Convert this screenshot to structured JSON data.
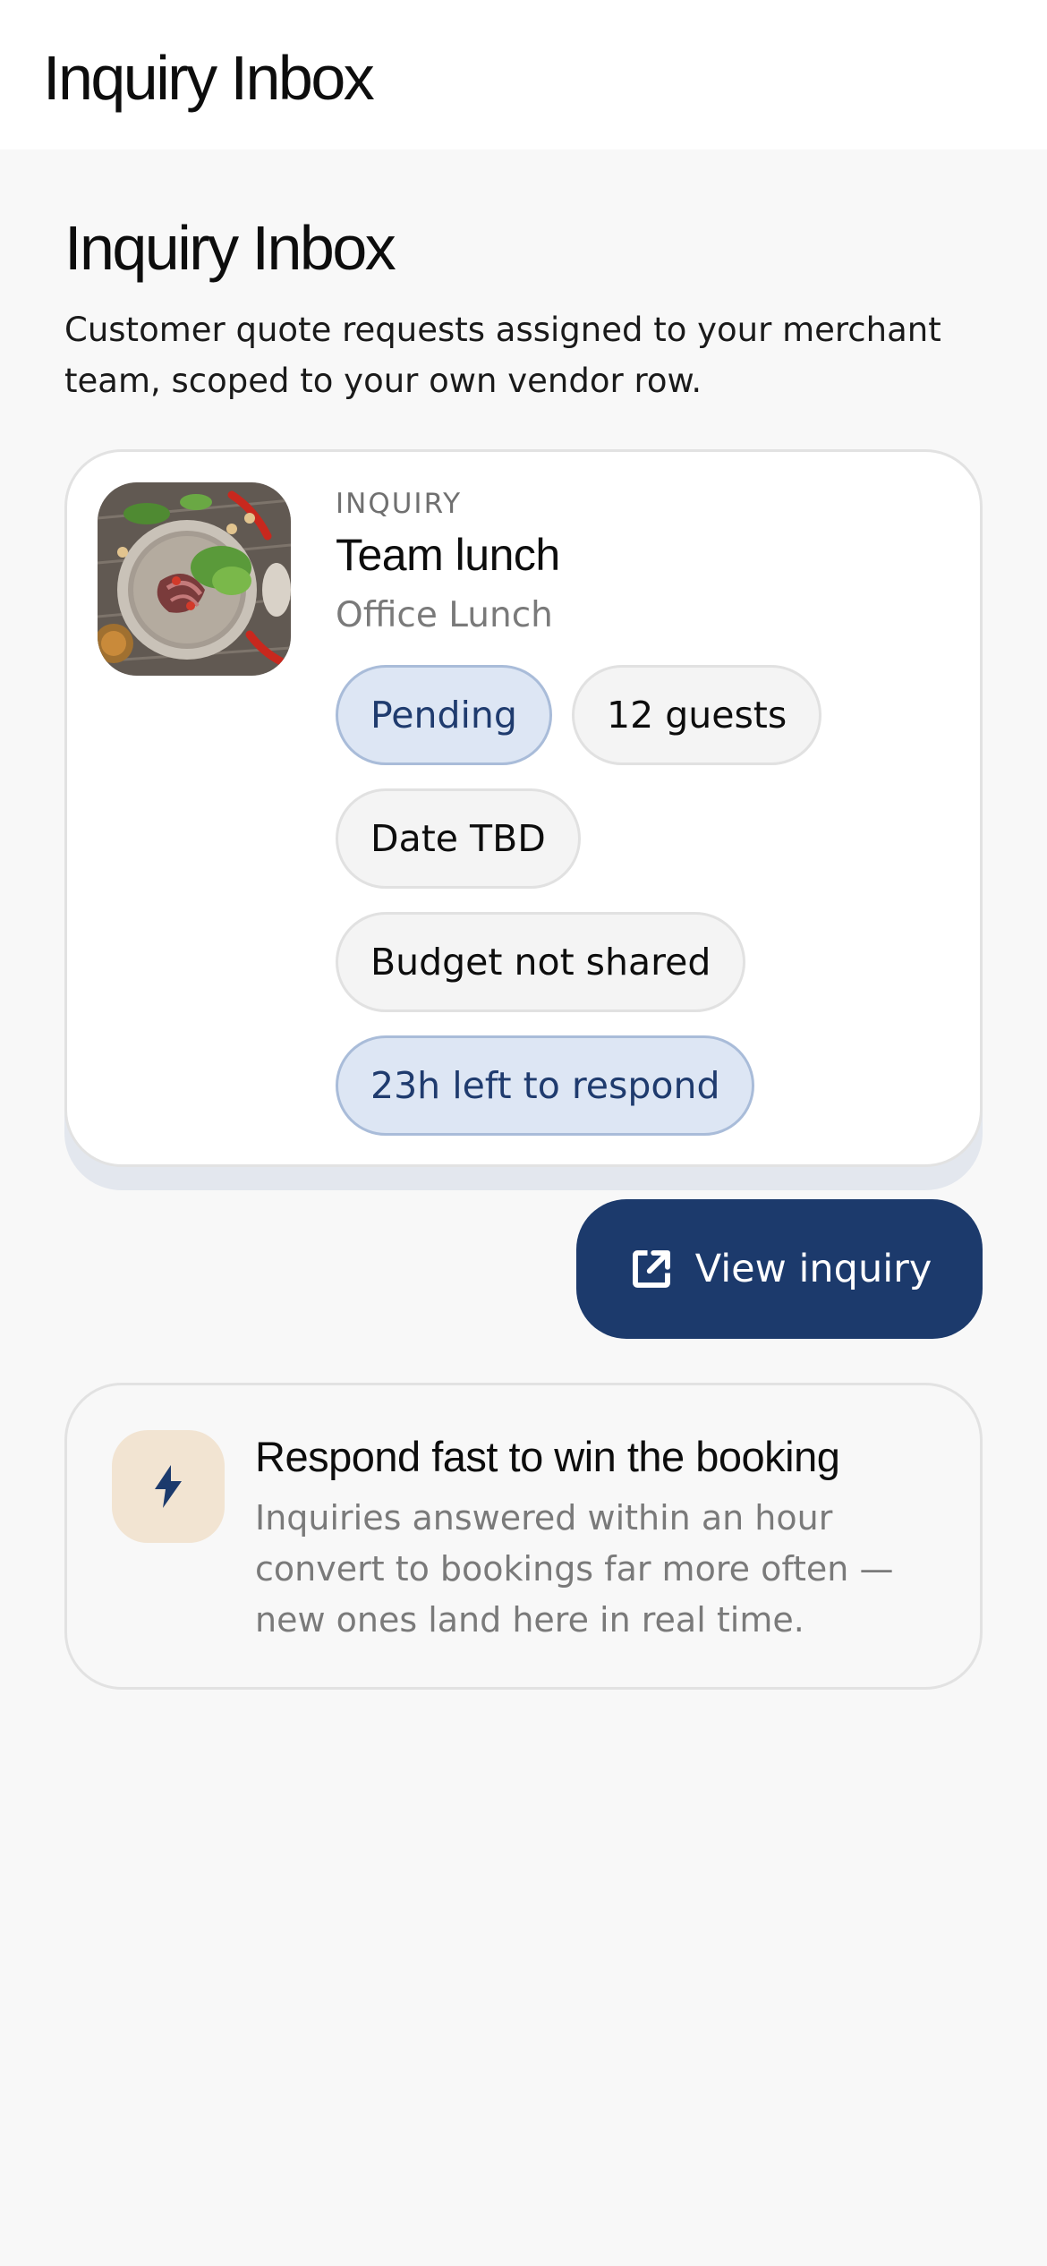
{
  "header": {
    "app_title": "Inquiry Inbox"
  },
  "page": {
    "title": "Inquiry Inbox",
    "description": "Customer quote requests assigned to your merchant team, scoped to your own vendor row."
  },
  "inquiry": {
    "eyebrow": "INQUIRY",
    "title": "Team lunch",
    "subtitle": "Office Lunch",
    "chips": {
      "status": "Pending",
      "guests": "12 guests",
      "date": "Date TBD",
      "budget": "Budget not shared",
      "deadline": "23h left to respond"
    },
    "thumbnail_icon": "food-plate-image",
    "view_button": {
      "label": "View inquiry",
      "icon": "open-external-icon"
    }
  },
  "tip": {
    "icon": "lightning-icon",
    "title": "Respond fast to win the booking",
    "body": "Inquiries answered within an hour convert to bookings far more often — new ones land here in real time."
  },
  "colors": {
    "accent": "#1c3a6c",
    "accent_chip_bg": "#dde6f4",
    "tip_icon_bg": "#f2e4d2"
  }
}
